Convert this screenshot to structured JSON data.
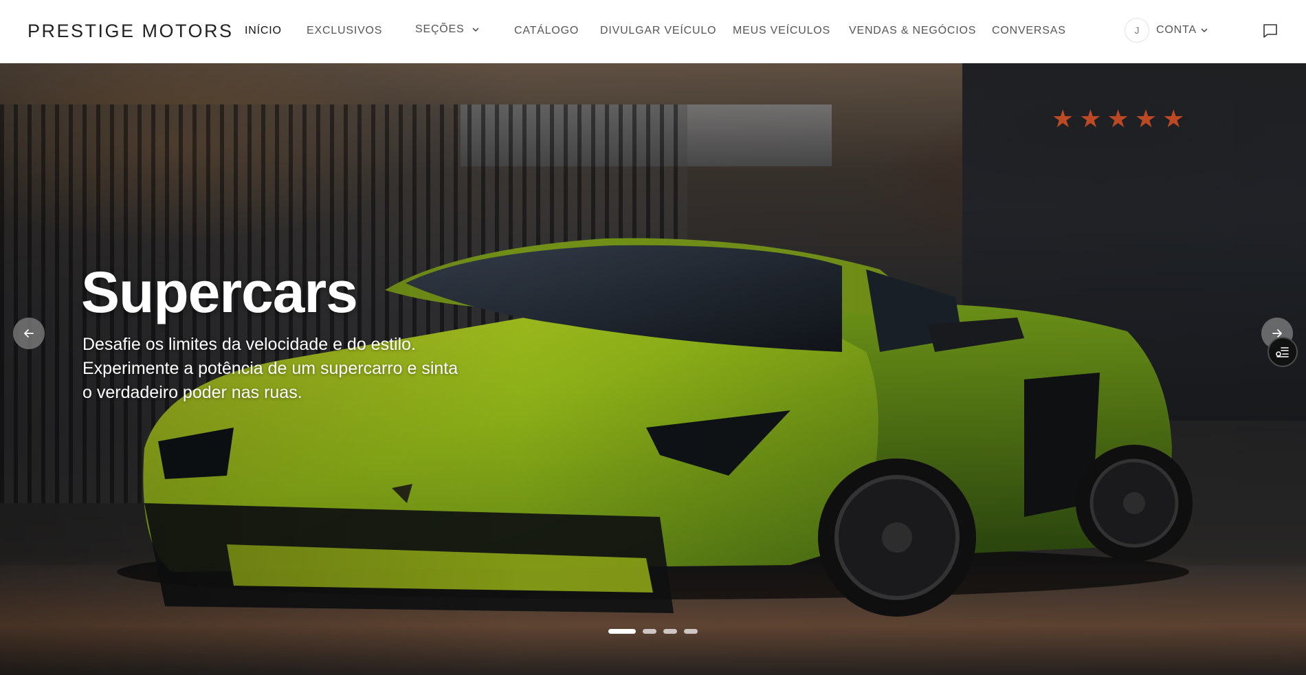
{
  "brand": "PRESTIGE MOTORS",
  "nav": {
    "inicio": "INÍCIO",
    "exclusivos": "EXCLUSIVOS",
    "secoes": "SEÇÕES",
    "catalogo": "CATÁLOGO",
    "divulgar": "DIVULGAR VEÍCULO",
    "meus_veiculos": "MEUS VEÍCULOS",
    "vendas": "VENDAS & NEGÓCIOS",
    "conversas": "CONVERSAS"
  },
  "account": {
    "avatar_initial": "J",
    "label": "CONTA"
  },
  "hero": {
    "title": "Supercars",
    "subtitle": "Desafie os limites da velocidade e do estilo. Experimente a potência de um supercarro e sinta o verdadeiro poder nas ruas.",
    "slides_total": 4,
    "active_slide": 1
  },
  "icons": {
    "secoes_caret": "chevron-down-icon",
    "account_caret": "chevron-down-icon",
    "chat": "message-square-icon",
    "prev": "arrow-left-icon",
    "next": "arrow-right-icon",
    "filter": "filter-list-icon"
  },
  "colors": {
    "nav_bg": "#ffffff",
    "nav_text": "#555555",
    "nav_active": "#111111",
    "car_body": "#9bc21a",
    "hero_text": "#ffffff"
  }
}
